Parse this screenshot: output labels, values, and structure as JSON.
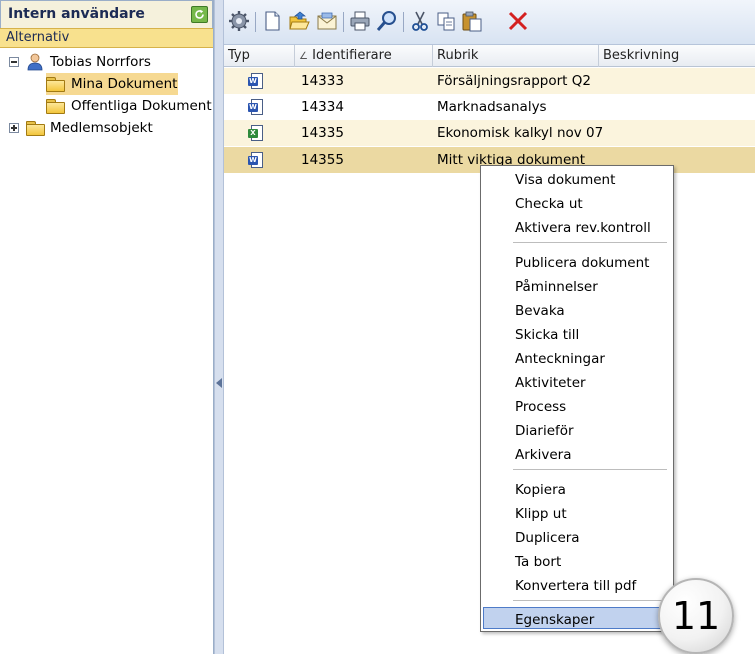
{
  "left_panel": {
    "title": "Intern användare",
    "alt_label": "Alternativ",
    "tree": {
      "user": "Tobias Norrfors",
      "my_docs": "Mina Dokument",
      "public_docs": "Offentliga Dokument",
      "member_objects": "Medlemsobjekt"
    }
  },
  "toolbar": {
    "icons": [
      "settings-icon",
      "new-document-icon",
      "open-folder-icon",
      "email-icon",
      "print-icon",
      "search-icon",
      "cut-icon",
      "copy-icon",
      "paste-icon",
      "delete-icon"
    ]
  },
  "grid": {
    "columns": {
      "type": "Typ",
      "id": "Identifierare",
      "title": "Rubrik",
      "desc": "Beskrivning"
    },
    "rows": [
      {
        "type": "word",
        "id": "14333",
        "title": "Försäljningsrapport Q2",
        "desc": ""
      },
      {
        "type": "word",
        "id": "14334",
        "title": "Marknadsanalys",
        "desc": ""
      },
      {
        "type": "excel",
        "id": "14335",
        "title": "Ekonomisk kalkyl nov 07",
        "desc": ""
      },
      {
        "type": "word",
        "id": "14355",
        "title": "Mitt viktiga dokument",
        "desc": ""
      }
    ]
  },
  "context_menu": {
    "groups": [
      [
        "Visa dokument",
        "Checka ut",
        "Aktivera rev.kontroll"
      ],
      [
        "Publicera dokument",
        "Påminnelser",
        "Bevaka",
        "Skicka till",
        "Anteckningar",
        "Aktiviteter",
        "Process",
        "Diarieför",
        "Arkivera"
      ],
      [
        "Kopiera",
        "Klipp ut",
        "Duplicera",
        "Ta bort",
        "Konvertera till pdf"
      ],
      [
        "Egenskaper"
      ]
    ],
    "highlighted": "Egenskaper"
  },
  "step_marker": "11",
  "colors": {
    "panel_header_bg": "#f5f1dc",
    "alt_bar_bg": "#f8e18e",
    "selected_row_bg": "#ebd9a2",
    "alt_row_bg": "#fbf4dd",
    "menu_highlight": "#c1d2ee",
    "delete_red": "#d42020"
  }
}
